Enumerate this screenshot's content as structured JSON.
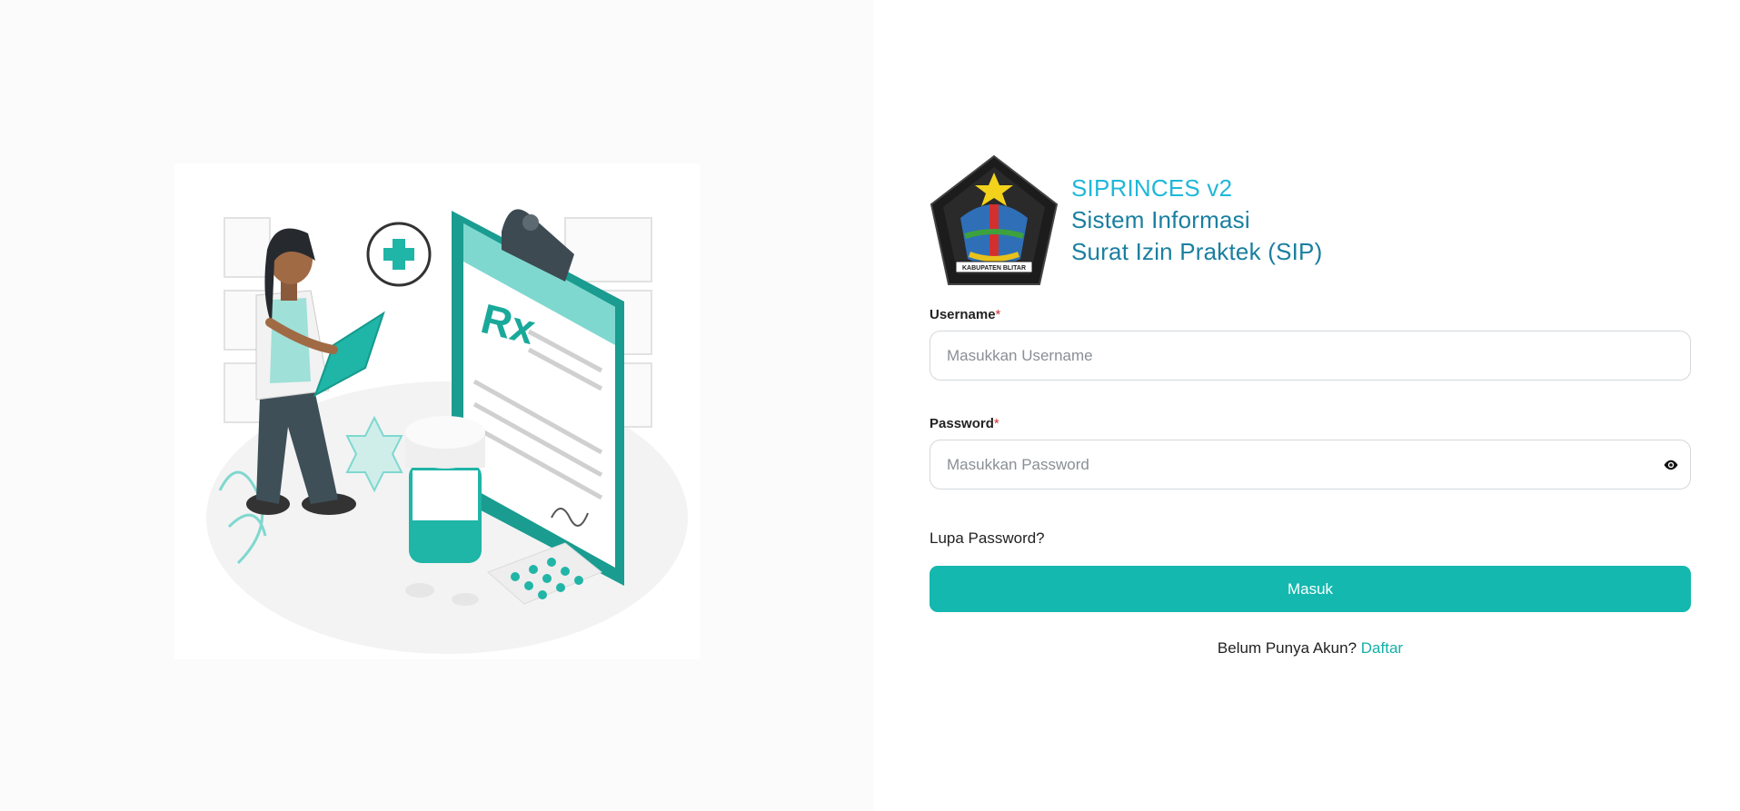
{
  "brand": {
    "app_name": "SIPRINCES v2",
    "subtitle_line1": "Sistem Informasi",
    "subtitle_line2": "Surat Izin Praktek (SIP)",
    "logo_caption": "KABUPATEN BLITAR"
  },
  "illustration": {
    "icon": "doctor-prescription-illustration",
    "rx_text": "Rx"
  },
  "form": {
    "username_label": "Username",
    "username_placeholder": "Masukkan Username",
    "username_value": "",
    "password_label": "Password",
    "password_placeholder": "Masukkan Password",
    "password_value": "",
    "required_mark": "*",
    "show_password_icon": "eye-icon",
    "forgot_password": "Lupa Password?",
    "submit_label": "Masuk",
    "no_account_text": "Belum Punya Akun?",
    "register_link": "Daftar"
  },
  "colors": {
    "accent": "#14b8ae",
    "brand_title": "#1fb8d8",
    "brand_subtitle": "#1a7fa0",
    "required": "#d32f2f"
  }
}
